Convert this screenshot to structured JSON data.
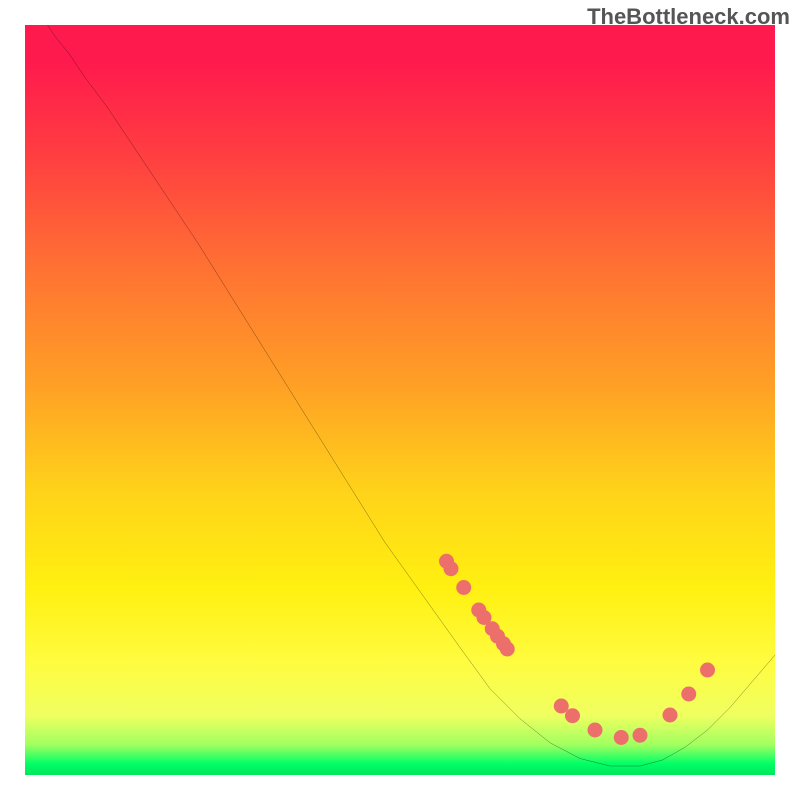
{
  "watermark": "TheBottleneck.com",
  "chart_data": {
    "type": "line",
    "title": "",
    "xlabel": "",
    "ylabel": "",
    "xlim": [
      0,
      100
    ],
    "ylim": [
      0,
      100
    ],
    "curve": [
      {
        "x": 3,
        "y": 100
      },
      {
        "x": 4,
        "y": 98.5
      },
      {
        "x": 6,
        "y": 96
      },
      {
        "x": 8,
        "y": 93
      },
      {
        "x": 11,
        "y": 89
      },
      {
        "x": 14,
        "y": 84.5
      },
      {
        "x": 18,
        "y": 78.5
      },
      {
        "x": 23,
        "y": 71
      },
      {
        "x": 28,
        "y": 63
      },
      {
        "x": 33,
        "y": 55
      },
      {
        "x": 38,
        "y": 47
      },
      {
        "x": 43,
        "y": 39
      },
      {
        "x": 48,
        "y": 31
      },
      {
        "x": 53,
        "y": 24
      },
      {
        "x": 58,
        "y": 17
      },
      {
        "x": 62,
        "y": 11.5
      },
      {
        "x": 66,
        "y": 7.5
      },
      {
        "x": 70,
        "y": 4.3
      },
      {
        "x": 74,
        "y": 2.2
      },
      {
        "x": 78,
        "y": 1.2
      },
      {
        "x": 82,
        "y": 1.2
      },
      {
        "x": 85,
        "y": 2
      },
      {
        "x": 88,
        "y": 3.7
      },
      {
        "x": 91,
        "y": 6
      },
      {
        "x": 94,
        "y": 9
      },
      {
        "x": 97,
        "y": 12.5
      },
      {
        "x": 100,
        "y": 16
      }
    ],
    "markers": [
      {
        "x": 56.2,
        "y": 28.5
      },
      {
        "x": 56.8,
        "y": 27.5
      },
      {
        "x": 58.5,
        "y": 25
      },
      {
        "x": 60.5,
        "y": 22
      },
      {
        "x": 61.2,
        "y": 21
      },
      {
        "x": 62.3,
        "y": 19.5
      },
      {
        "x": 63.0,
        "y": 18.5
      },
      {
        "x": 63.8,
        "y": 17.5
      },
      {
        "x": 64.3,
        "y": 16.8
      },
      {
        "x": 71.5,
        "y": 9.2
      },
      {
        "x": 73.0,
        "y": 7.9
      },
      {
        "x": 76.0,
        "y": 6.0
      },
      {
        "x": 79.5,
        "y": 5.0
      },
      {
        "x": 82.0,
        "y": 5.3
      },
      {
        "x": 86.0,
        "y": 8.0
      },
      {
        "x": 88.5,
        "y": 10.8
      },
      {
        "x": 91.0,
        "y": 14
      }
    ],
    "marker_color": "#ed6f6b",
    "curve_color": "#000000",
    "gradient_stops": [
      {
        "pos": 0,
        "color": "#ff1a4d"
      },
      {
        "pos": 5,
        "color": "#ff1a4d"
      },
      {
        "pos": 18,
        "color": "#ff4040"
      },
      {
        "pos": 32,
        "color": "#ff7033"
      },
      {
        "pos": 48,
        "color": "#ffa025"
      },
      {
        "pos": 62,
        "color": "#ffd21a"
      },
      {
        "pos": 75,
        "color": "#fff010"
      },
      {
        "pos": 85,
        "color": "#fffc40"
      },
      {
        "pos": 92,
        "color": "#f0ff60"
      },
      {
        "pos": 96,
        "color": "#a0ff60"
      },
      {
        "pos": 98.5,
        "color": "#00ff66"
      },
      {
        "pos": 100,
        "color": "#00e65c"
      }
    ]
  }
}
